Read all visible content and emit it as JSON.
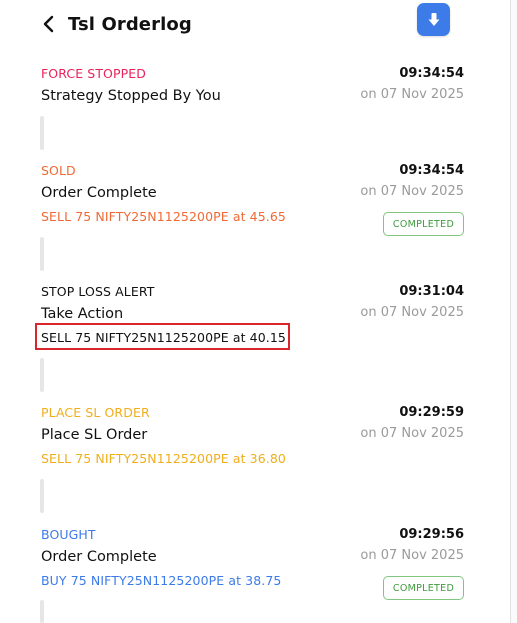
{
  "header": {
    "title": "Tsl Orderlog",
    "back_icon": "chevron-left-icon",
    "download_icon": "download-arrow-icon"
  },
  "colors": {
    "force_stopped": "#e8235a",
    "sold": "#f06a36",
    "alert": "#111111",
    "place_sl": "#f0ae1c",
    "bought": "#3d7be8",
    "completed_badge": "#3e9a3e",
    "download_button": "#3d7be8",
    "highlight_box": "#d9262c"
  },
  "entries": [
    {
      "status": "FORCE STOPPED",
      "message": "Strategy Stopped By You",
      "order": "",
      "time": "09:34:54",
      "date": "on 07 Nov 2025",
      "badge": ""
    },
    {
      "status": "SOLD",
      "message": "Order Complete",
      "order": "SELL 75 NIFTY25N1125200PE at 45.65",
      "time": "09:34:54",
      "date": "on 07 Nov 2025",
      "badge": "COMPLETED"
    },
    {
      "status": "STOP LOSS ALERT",
      "message": "Take Action",
      "order": "SELL 75 NIFTY25N1125200PE at 40.15",
      "time": "09:31:04",
      "date": "on 07 Nov 2025",
      "badge": ""
    },
    {
      "status": "PLACE SL ORDER",
      "message": "Place SL Order",
      "order": "SELL 75 NIFTY25N1125200PE at 36.80",
      "time": "09:29:59",
      "date": "on 07 Nov 2025",
      "badge": ""
    },
    {
      "status": "BOUGHT",
      "message": "Order Complete",
      "order": "BUY 75 NIFTY25N1125200PE at 38.75",
      "time": "09:29:56",
      "date": "on 07 Nov 2025",
      "badge": "COMPLETED"
    }
  ]
}
